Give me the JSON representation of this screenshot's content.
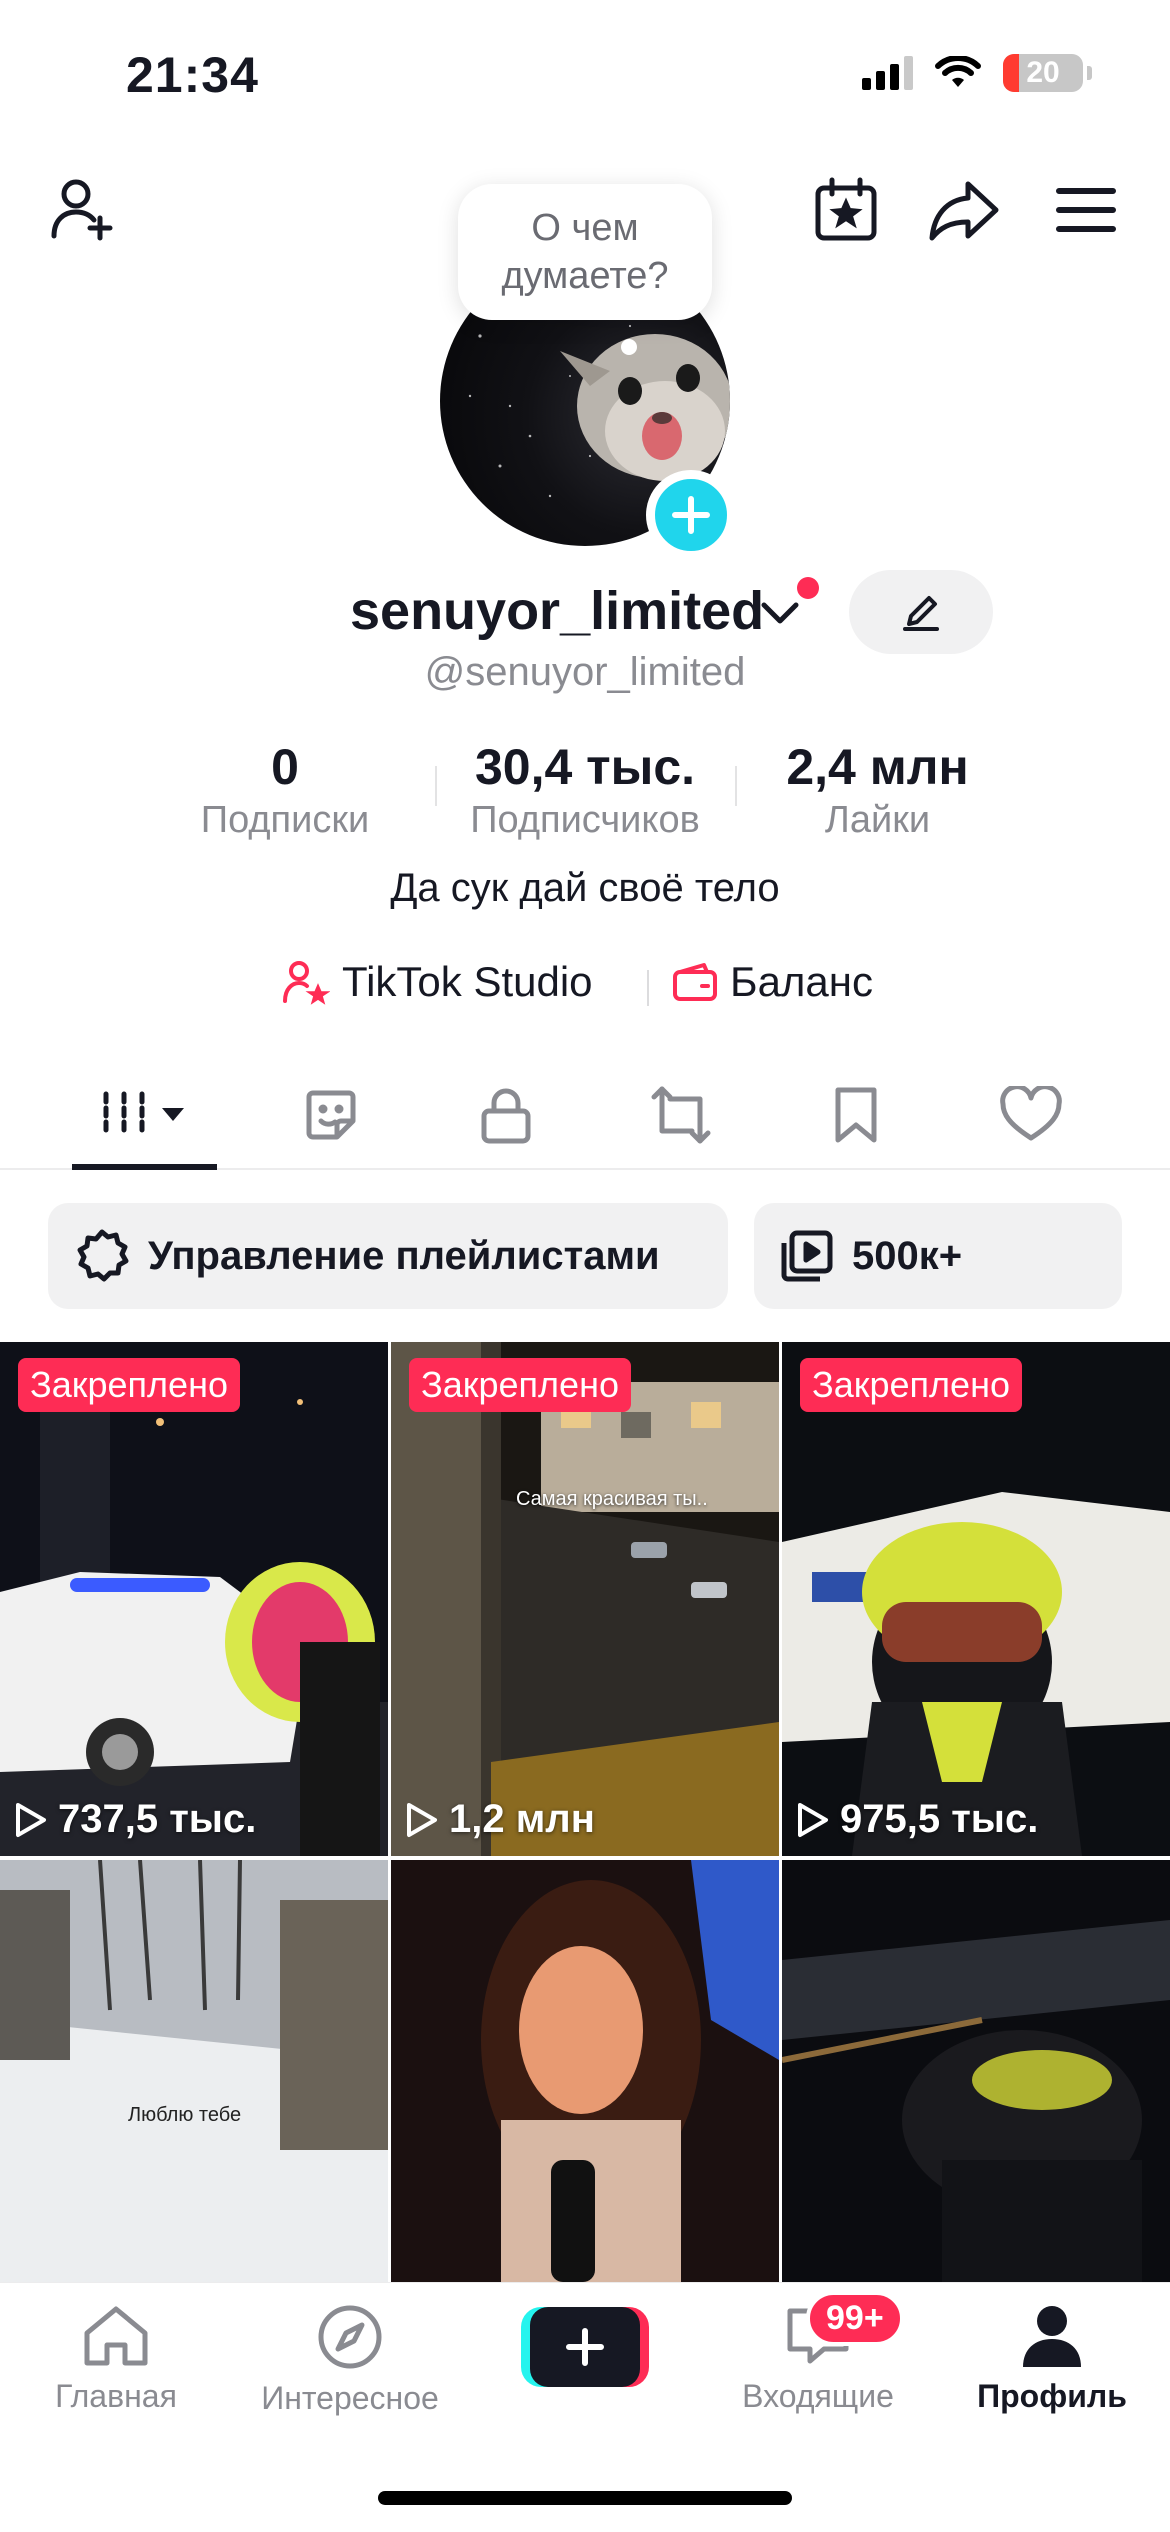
{
  "status_bar": {
    "time": "21:34",
    "battery": "20",
    "battery_level": 0.2
  },
  "bubble": {
    "text": "О чем думаете?"
  },
  "profile": {
    "username": "senuyor_limited",
    "handle": "@senuyor_limited",
    "bio": "Да сук дай своё тело"
  },
  "stats": [
    {
      "value": "0",
      "label": "Подписки"
    },
    {
      "value": "30,4 тыс.",
      "label": "Подписчиков"
    },
    {
      "value": "2,4 млн",
      "label": "Лайки"
    }
  ],
  "links": {
    "studio": "TikTok Studio",
    "balance": "Баланс"
  },
  "icons": {
    "add_friend": "add-user-icon",
    "calendar": "calendar-star-icon",
    "share": "share-icon",
    "menu": "hamburger-menu-icon",
    "tabs": [
      "grid-icon",
      "sticker-icon",
      "lock-icon",
      "repost-icon",
      "bookmark-icon",
      "heart-icon"
    ]
  },
  "playlists": {
    "manage": "Управление плейлистами",
    "count": "500к+"
  },
  "videos": [
    {
      "pinned": "Закреплено",
      "views": "737,5 тыс."
    },
    {
      "pinned": "Закреплено",
      "views": "1,2 млн",
      "caption": "Самая красивая ты.."
    },
    {
      "pinned": "Закреплено",
      "views": "975,5 тыс."
    },
    {
      "caption": "Люблю тебе"
    },
    {},
    {}
  ],
  "nav": {
    "home": "Главная",
    "discover": "Интересное",
    "inbox": "Входящие",
    "inbox_badge": "99+",
    "profile": "Профиль"
  },
  "colors": {
    "accent": "#fe2c55",
    "cyan": "#20d5ec",
    "text": "#161823",
    "muted": "#8a8b91"
  }
}
